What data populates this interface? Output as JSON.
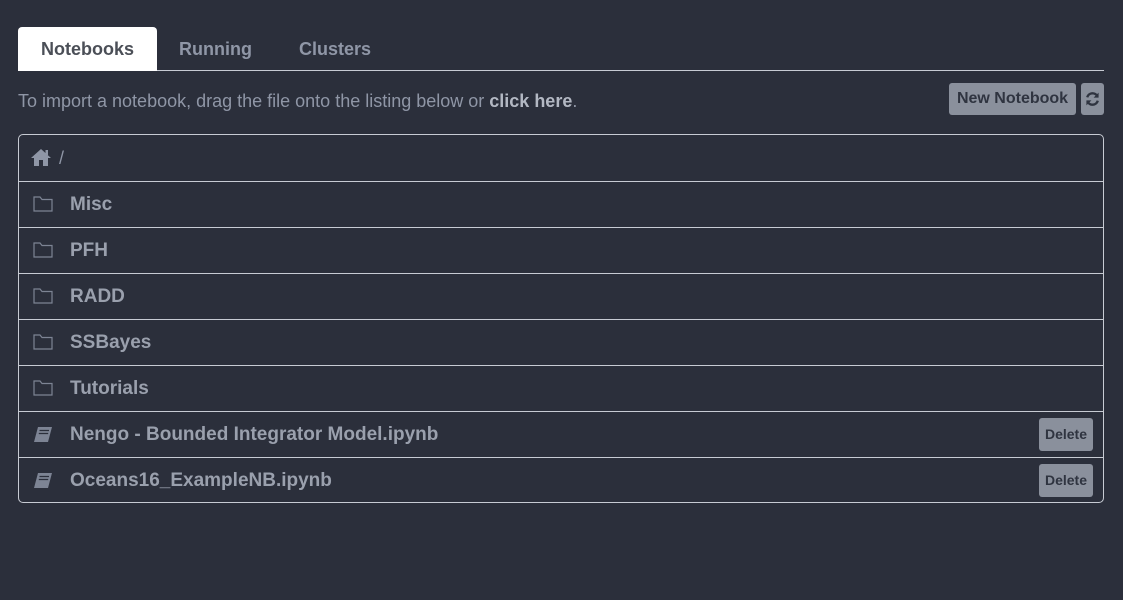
{
  "tabs": [
    {
      "label": "Notebooks"
    },
    {
      "label": "Running"
    },
    {
      "label": "Clusters"
    }
  ],
  "hint": {
    "text": "To import a notebook, drag the file onto the listing below or ",
    "link": "click here",
    "suffix": "."
  },
  "toolbar": {
    "new_notebook": "New Notebook",
    "refresh_icon": "refresh-icon"
  },
  "breadcrumb": {
    "home_icon": "home-icon",
    "separator": "/"
  },
  "folders": [
    {
      "name": "Misc"
    },
    {
      "name": "PFH"
    },
    {
      "name": "RADD"
    },
    {
      "name": "SSBayes"
    },
    {
      "name": "Tutorials"
    }
  ],
  "notebooks": [
    {
      "name": "Nengo - Bounded Integrator Model.ipynb",
      "delete_label": "Delete"
    },
    {
      "name": "Oceans16_ExampleNB.ipynb",
      "delete_label": "Delete"
    }
  ],
  "colors": {
    "background": "#2b2f3b",
    "text": "#8f96a6",
    "border": "#c7cbd3",
    "button": "#8a909c"
  }
}
